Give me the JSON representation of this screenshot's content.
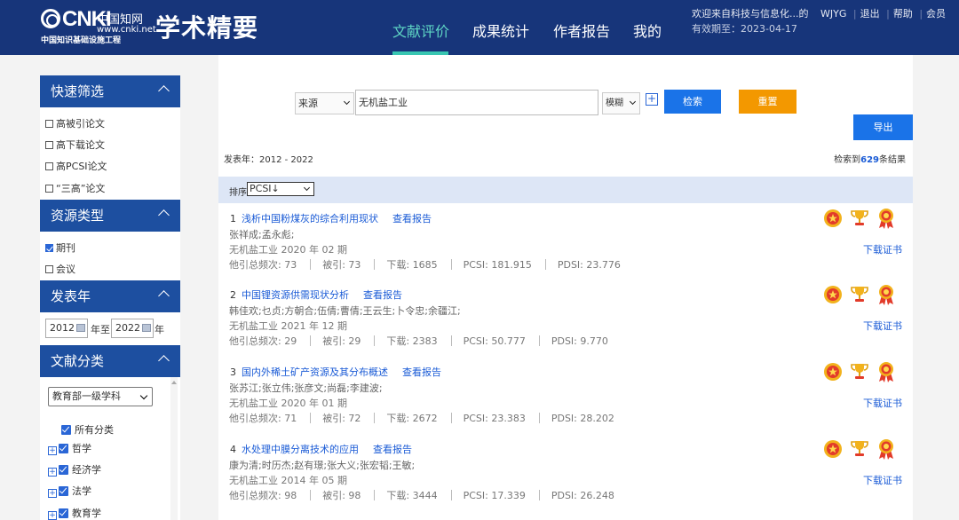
{
  "header": {
    "logo_brand": "CNKI",
    "logo_chinese": "中国知网",
    "logo_url": "www.cnki.net",
    "logo_project": "中国知识基础设施工程",
    "app_title": "学术精要",
    "nav": [
      "文献评价",
      "成果统计",
      "作者报告",
      "我的"
    ],
    "active_nav": "文献评价",
    "welcome": "欢迎来自科技与信息化...的",
    "user": "WJYG",
    "logout": "退出",
    "help": "帮助",
    "member": "会员",
    "validity": "有效期至：2023-04-17"
  },
  "sidebar": {
    "quick_filter": {
      "title": "快速筛选",
      "options": [
        "高被引论文",
        "高下载论文",
        "高PCSI论文",
        "“三高”论文"
      ]
    },
    "resource_type": {
      "title": "资源类型",
      "options": [
        {
          "label": "期刊",
          "checked": true
        },
        {
          "label": "会议",
          "checked": false
        }
      ]
    },
    "pub_year": {
      "title": "发表年",
      "from": "2012",
      "to_label": "年至",
      "to": "2022",
      "year_suffix": "年"
    },
    "doc_class": {
      "title": "文献分类",
      "select": "教育部一级学科",
      "items": [
        {
          "label": "所有分类",
          "expandable": false
        },
        {
          "label": "哲学",
          "expandable": true
        },
        {
          "label": "经济学",
          "expandable": true
        },
        {
          "label": "法学",
          "expandable": true
        },
        {
          "label": "教育学",
          "expandable": true
        }
      ]
    }
  },
  "search": {
    "field": "来源",
    "keyword": "无机盐工业",
    "match": "模糊",
    "search_label": "检索",
    "reset_label": "重置",
    "export_label": "导出"
  },
  "summary": {
    "year_range": "发表年：2012 - 2022",
    "found_prefix": "检索到",
    "found_count": "629",
    "found_suffix": "条结果"
  },
  "sort": {
    "label": "排序",
    "value": "PCSI↓"
  },
  "results": [
    {
      "num": "1",
      "title": "浅析中国粉煤灰的综合利用现状",
      "report": "查看报告",
      "authors": "张祥成;孟永彪;",
      "source": "无机盐工业 2020 年 02 期",
      "cited_other": "他引总频次: 73",
      "cited": "被引: 73",
      "downloads": "下载: 1685",
      "pcsi": "PCSI: 181.915",
      "pdsi": "PDSI: 23.776",
      "cert": "下载证书"
    },
    {
      "num": "2",
      "title": "中国锂资源供需现状分析",
      "report": "查看报告",
      "authors": "韩佳欢;乜贞;方朝合;伍倩;曹倩;王云生;卜令忠;余疆江;",
      "source": "无机盐工业 2021 年 12 期",
      "cited_other": "他引总频次: 29",
      "cited": "被引: 29",
      "downloads": "下载: 2383",
      "pcsi": "PCSI: 50.777",
      "pdsi": "PDSI: 9.770",
      "cert": "下载证书"
    },
    {
      "num": "3",
      "title": "国内外稀土矿产资源及其分布概述",
      "report": "查看报告",
      "authors": "张苏江;张立伟;张彦文;尚磊;李建波;",
      "source": "无机盐工业 2020 年 01 期",
      "cited_other": "他引总频次: 71",
      "cited": "被引: 72",
      "downloads": "下载: 2672",
      "pcsi": "PCSI: 23.383",
      "pdsi": "PDSI: 28.202",
      "cert": "下载证书"
    },
    {
      "num": "4",
      "title": "水处理中膜分离技术的应用",
      "report": "查看报告",
      "authors": "康为清;时历杰;赵有璟;张大义;张宏韬;王敏;",
      "source": "无机盐工业 2014 年 05 期",
      "cited_other": "他引总频次: 98",
      "cited": "被引: 98",
      "downloads": "下载: 3444",
      "pcsi": "PCSI: 17.339",
      "pdsi": "PDSI: 26.248",
      "cert": "下载证书"
    }
  ],
  "medal_icons": [
    "high-cited-medal-icon",
    "high-download-trophy-icon",
    "high-pcsi-rosette-icon"
  ],
  "colors": {
    "header_bg": "#17357a",
    "sidebar_head": "#1d4fa0",
    "link": "#1a5bd6",
    "primary_button": "#1a73e8",
    "reset_button": "#f39800",
    "nav_active": "#5fd6c4"
  }
}
